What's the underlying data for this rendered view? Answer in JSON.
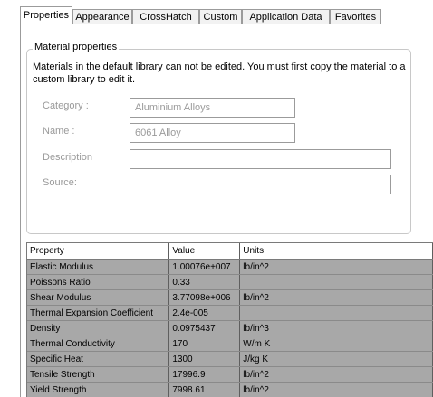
{
  "tabs": [
    {
      "label": "Properties",
      "active": true
    },
    {
      "label": "Appearance",
      "active": false
    },
    {
      "label": "CrossHatch",
      "active": false
    },
    {
      "label": "Custom",
      "active": false
    },
    {
      "label": "Application Data",
      "active": false
    },
    {
      "label": "Favorites",
      "active": false
    }
  ],
  "material": {
    "group_title": "Material properties",
    "note": "Materials in the default library can not be edited. You must first copy the material to a custom library to edit it.",
    "category_label": "Category :",
    "category_value": "Aluminium Alloys",
    "name_label": "Name :",
    "name_value": "6061 Alloy",
    "description_label": "Description",
    "description_value": "",
    "source_label": "Source:",
    "source_value": ""
  },
  "grid": {
    "headers": [
      "Property",
      "Value",
      "Units"
    ],
    "rows": [
      [
        "Elastic Modulus",
        "1.00076e+007",
        "lb/in^2"
      ],
      [
        "Poissons Ratio",
        "0.33",
        ""
      ],
      [
        "Shear Modulus",
        "3.77098e+006",
        "lb/in^2"
      ],
      [
        "Thermal Expansion Coefficient",
        "2.4e-005",
        ""
      ],
      [
        "Density",
        "0.0975437",
        "lb/in^3"
      ],
      [
        "Thermal Conductivity",
        "170",
        "W/m K"
      ],
      [
        "Specific Heat",
        "1300",
        "J/kg K"
      ],
      [
        "Tensile Strength",
        "17996.9",
        "lb/in^2"
      ],
      [
        "Yield Strength",
        "7998.61",
        "lb/in^2"
      ]
    ]
  }
}
